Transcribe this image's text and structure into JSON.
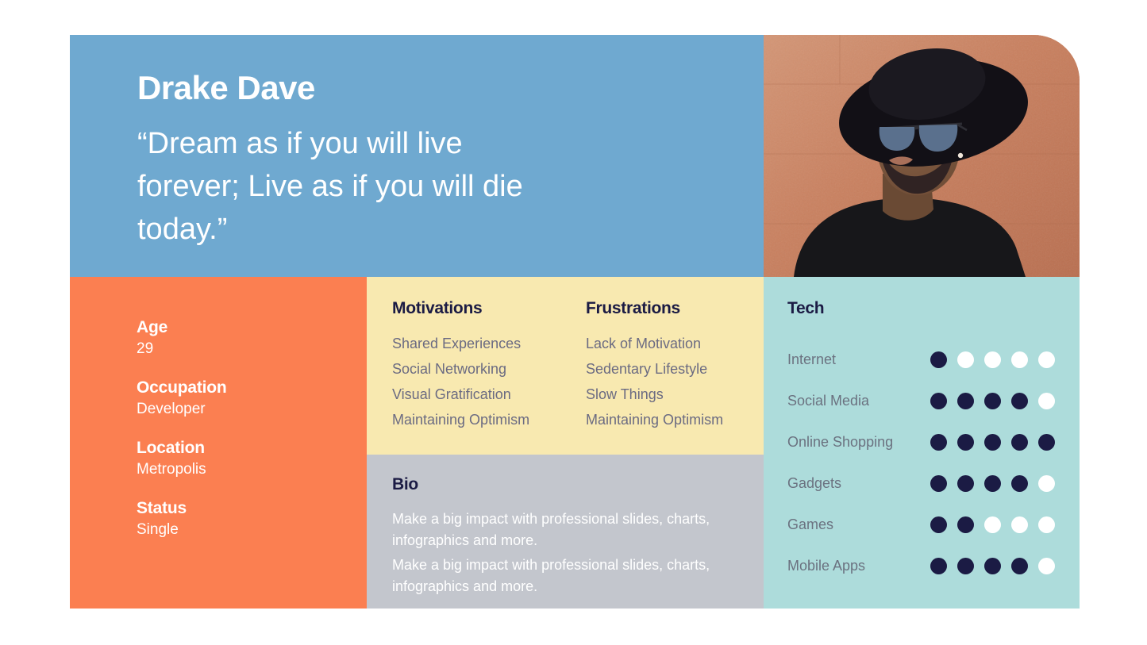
{
  "persona": {
    "name": "Drake Dave",
    "quote": "“Dream as if you will live forever; Live as if you will die today.”",
    "photo_alt": "portrait-photo"
  },
  "colors": {
    "blue": "#6FA9D0",
    "orange": "#FB7F51",
    "cream": "#F8E9B0",
    "gray": "#C3C6CD",
    "teal": "#ADDCDB",
    "navy": "#1B1B44",
    "white": "#FFFFFF"
  },
  "demographics": [
    {
      "label": "Age",
      "value": "29"
    },
    {
      "label": "Occupation",
      "value": "Developer"
    },
    {
      "label": "Location",
      "value": "Metropolis"
    },
    {
      "label": "Status",
      "value": "Single"
    }
  ],
  "motivations": {
    "heading": "Motivations",
    "items": [
      "Shared Experiences",
      "Social Networking",
      "Visual Gratification",
      "Maintaining Optimism"
    ]
  },
  "frustrations": {
    "heading": "Frustrations",
    "items": [
      "Lack of Motivation",
      "Sedentary Lifestyle",
      "Slow Things",
      "Maintaining Optimism"
    ]
  },
  "bio": {
    "heading": "Bio",
    "paragraphs": [
      "Make a big impact with professional slides, charts, infographics and more.",
      "Make a big impact with professional slides, charts, infographics and more."
    ]
  },
  "tech": {
    "heading": "Tech",
    "max_rating": 5,
    "rows": [
      {
        "label": "Internet",
        "rating": 1
      },
      {
        "label": "Social Media",
        "rating": 4
      },
      {
        "label": "Online Shopping",
        "rating": 5
      },
      {
        "label": "Gadgets",
        "rating": 4
      },
      {
        "label": "Games",
        "rating": 2
      },
      {
        "label": "Mobile Apps",
        "rating": 4
      }
    ]
  }
}
